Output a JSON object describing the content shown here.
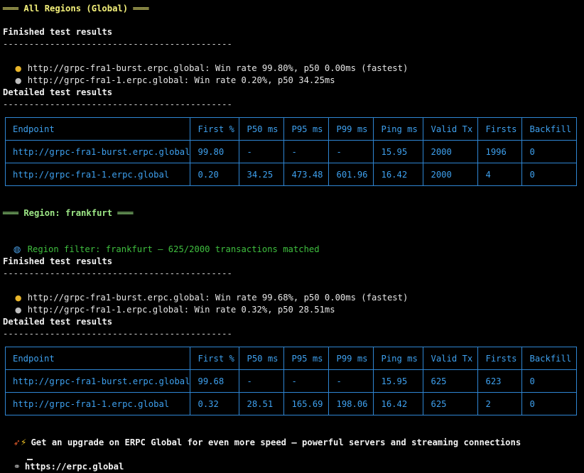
{
  "global": {
    "header": "═══ All Regions (Global) ═══",
    "finished_title": "Finished test results",
    "separator": "--------------------------------------------",
    "results": [
      {
        "medal": "gold",
        "text": "http://grpc-fra1-burst.erpc.global: Win rate 99.80%, p50 0.00ms (fastest)"
      },
      {
        "medal": "silver",
        "text": "http://grpc-fra1-1.erpc.global: Win rate 0.20%, p50 34.25ms"
      }
    ],
    "detailed_title": "Detailed test results",
    "table": {
      "headers": [
        "Endpoint",
        "First %",
        "P50 ms",
        "P95 ms",
        "P99 ms",
        "Ping ms",
        "Valid Tx",
        "Firsts",
        "Backfill"
      ],
      "rows": [
        [
          "http://grpc-fra1-burst.erpc.global",
          "99.80",
          "-",
          "-",
          "-",
          "15.95",
          "2000",
          "1996",
          "0"
        ],
        [
          "http://grpc-fra1-1.erpc.global",
          "0.20",
          "34.25",
          "473.48",
          "601.96",
          "16.42",
          "2000",
          "4",
          "0"
        ]
      ]
    }
  },
  "region": {
    "header": "═══ Region: frankfurt ═══",
    "filter_text": "Region filter: frankfurt — 625/2000 transactions matched",
    "finished_title": "Finished test results",
    "separator": "--------------------------------------------",
    "results": [
      {
        "medal": "gold",
        "text": "http://grpc-fra1-burst.erpc.global: Win rate 99.68%, p50 0.00ms (fastest)"
      },
      {
        "medal": "silver",
        "text": "http://grpc-fra1-1.erpc.global: Win rate 0.32%, p50 28.51ms"
      }
    ],
    "detailed_title": "Detailed test results",
    "table": {
      "headers": [
        "Endpoint",
        "First %",
        "P50 ms",
        "P95 ms",
        "P99 ms",
        "Ping ms",
        "Valid Tx",
        "Firsts",
        "Backfill"
      ],
      "rows": [
        [
          "http://grpc-fra1-burst.erpc.global",
          "99.68",
          "-",
          "-",
          "-",
          "15.95",
          "625",
          "623",
          "0"
        ],
        [
          "http://grpc-fra1-1.erpc.global",
          "0.32",
          "28.51",
          "165.69",
          "198.06",
          "16.42",
          "625",
          "2",
          "0"
        ]
      ]
    }
  },
  "footer": {
    "promo_text": "Get an upgrade on ERPC Global for even more speed — powerful servers and streaming connections",
    "link_text": "https://erpc.global"
  },
  "colors": {
    "background": "#000000",
    "table_text": "#3ea0ee",
    "table_border": "#2f86d3",
    "header_yellow": "#f4f17a",
    "header_green": "#9ee887",
    "filter_green": "#3fbf3f"
  },
  "icons": {
    "gold_medal": "gold-medal-icon",
    "silver_medal": "silver-medal-icon",
    "globe": "globe-icon",
    "rocket": "rocket-icon",
    "lightning": "lightning-icon",
    "link": "link-icon"
  }
}
